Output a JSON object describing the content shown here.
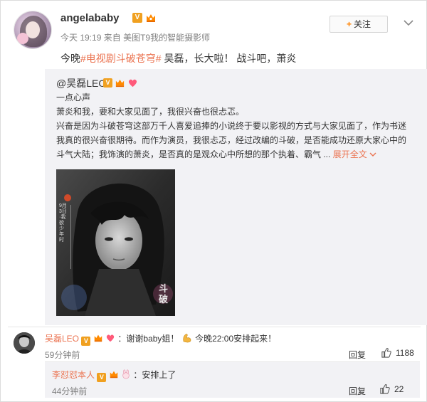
{
  "post": {
    "username": "angelababy",
    "v_badge": "V",
    "meta_time": "今天 19:19",
    "meta_from": "来自",
    "meta_source": "美图T9我的智能摄影师",
    "follow_label": "关注",
    "text_prefix": "今晚",
    "text_tag": "#电视剧斗破苍穹#",
    "text_suffix": " 吴磊，长大啦！ 战斗吧，萧炎"
  },
  "repost": {
    "author": "@吴磊LEO",
    "v_badge": "V",
    "lines": [
      "一点心声",
      "萧炎和我，要和大家见面了，我很兴奋也很忐忑。",
      "兴奋是因为斗破苍穹这部万千人喜爱追捧的小说终于要以影视的方式与大家见面了，作为书迷",
      "我真的很兴奋很期待。而作为演员，我很忐忑，经过改编的斗破，是否能成功还原大家心中的",
      "斗气大陆；我饰演的萧炎，是否真的是观众心中所想的那个执着、霸气 ..."
    ],
    "expand_label": "展开全文",
    "poster_text_date": "9月3日·我欲少年时",
    "poster_title": "斗破"
  },
  "comments": [
    {
      "name": "吴磊LEO",
      "v_badge": "V",
      "text_a": "：谢谢baby姐！",
      "text_b": "今晚22:00安排起来！",
      "time": "59分钟前",
      "reply_label": "回复",
      "likes": "1188"
    }
  ],
  "sub_comment": {
    "name": "李怼怼本人",
    "v_badge": "V",
    "text": "：安排上了",
    "time": "44分钟前",
    "reply_label": "回复",
    "likes": "22"
  },
  "icons": {
    "crown": "crown-icon",
    "heart": "heart-icon",
    "muscle": "muscle-emoji-icon",
    "thumb": "thumbs-up-icon",
    "chevron": "chevron-down-icon"
  },
  "colors": {
    "accent": "#eb7350",
    "badge": "#f0a020",
    "follow_plus": "#ff8200",
    "repost_bg": "#f2f2f5"
  }
}
